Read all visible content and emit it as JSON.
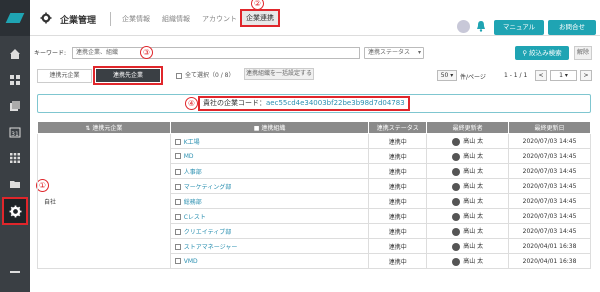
{
  "header": {
    "title": "企業管理",
    "tabs": [
      "企業情報",
      "組織情報",
      "アカウント",
      "企業連携"
    ],
    "active_tab": "企業連携",
    "marker": "②",
    "buttons": {
      "manual": "マニュアル",
      "contact": "お問合せ"
    }
  },
  "filter": {
    "keyword_label": "キーワード:",
    "keyword_placeholder": "連携企業、組織",
    "status_select": "連携ステータス",
    "marker": "③",
    "search_button": "絞込み検索",
    "clear_button": "解除"
  },
  "tabs": {
    "source": "連携元企業",
    "target": "連携先企業"
  },
  "controls": {
    "select_all": "全て選択（0 / 8）",
    "bulk_button": "連携組織を一括設定する",
    "per_page": "50",
    "per_page_label": "件/ページ",
    "range": "1 - 1 / 1",
    "prev": "<",
    "page": "1",
    "next": ">"
  },
  "code_box": {
    "marker": "④",
    "label": "貴社の企業コード：",
    "code": "aec55cd4e34003bf22be3b98d7d04783"
  },
  "sidebar": {
    "marker": "①"
  },
  "table": {
    "headers": [
      "連携元企業",
      "連携組織",
      "連携ステータス",
      "最終更新者",
      "最終更新日"
    ],
    "company": "自社",
    "rows": [
      {
        "org": "K工場",
        "status": "連携中",
        "user": "高山 太",
        "date": "2020/07/03 14:45"
      },
      {
        "org": "MD",
        "status": "連携中",
        "user": "高山 太",
        "date": "2020/07/03 14:45"
      },
      {
        "org": "人事部",
        "status": "連携中",
        "user": "高山 太",
        "date": "2020/07/03 14:45"
      },
      {
        "org": "マーケティング部",
        "status": "連携中",
        "user": "高山 太",
        "date": "2020/07/03 14:45"
      },
      {
        "org": "総務部",
        "status": "連携中",
        "user": "高山 太",
        "date": "2020/07/03 14:45"
      },
      {
        "org": "Cレスト",
        "status": "連携中",
        "user": "高山 太",
        "date": "2020/07/03 14:45"
      },
      {
        "org": "クリエイティブ部",
        "status": "連携中",
        "user": "高山 太",
        "date": "2020/07/03 14:45"
      },
      {
        "org": "ストアマネージャー",
        "status": "連携中",
        "user": "高山 太",
        "date": "2020/04/01 16:38"
      },
      {
        "org": "VMD",
        "status": "連携中",
        "user": "高山 太",
        "date": "2020/04/01 16:38"
      }
    ]
  }
}
